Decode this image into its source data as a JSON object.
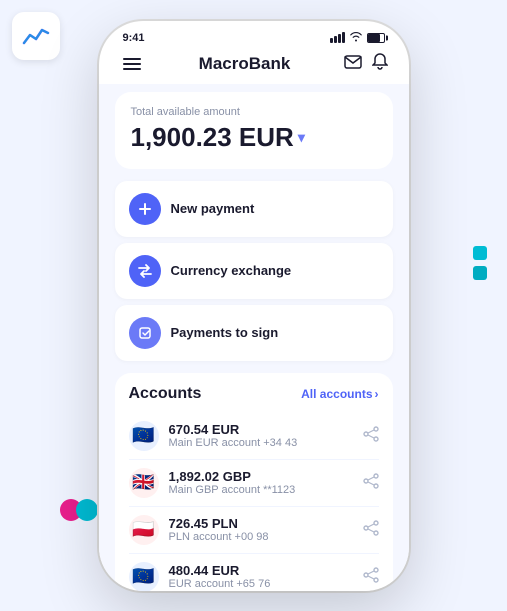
{
  "app": {
    "title": "MacroBank"
  },
  "status_bar": {
    "time": "9:41"
  },
  "nav": {
    "title": "MacroBank"
  },
  "balance": {
    "label": "Total available amount",
    "amount": "1,900.23 EUR"
  },
  "actions": [
    {
      "id": "new-payment",
      "label": "New payment",
      "icon": "+"
    },
    {
      "id": "currency-exchange",
      "label": "Currency exchange",
      "icon": "↔"
    },
    {
      "id": "payments-to-sign",
      "label": "Payments to sign",
      "icon": "✎"
    }
  ],
  "accounts": {
    "title": "Accounts",
    "link_label": "All accounts",
    "items": [
      {
        "id": "eur1",
        "flag": "🇪🇺",
        "amount": "670.54 EUR",
        "name": "Main EUR account +34 43",
        "flag_bg": "#e8f0ff"
      },
      {
        "id": "gbp1",
        "flag": "🇬🇧",
        "amount": "1,892.02 GBP",
        "name": "Main GBP account **1123",
        "flag_bg": "#fff0f0"
      },
      {
        "id": "pln1",
        "flag": "🇵🇱",
        "amount": "726.45 PLN",
        "name": "PLN account +00 98",
        "flag_bg": "#fff0f0"
      },
      {
        "id": "eur2",
        "flag": "🇪🇺",
        "amount": "480.44 EUR",
        "name": "EUR account +65 76",
        "flag_bg": "#e8f0ff"
      }
    ]
  },
  "decorations": {
    "chart_icon": "📈",
    "dot1_color": "#00bcd4",
    "dot2_color": "#00acc1",
    "circle_pink": "#e91e8c",
    "circle_teal": "#00bcd4"
  }
}
